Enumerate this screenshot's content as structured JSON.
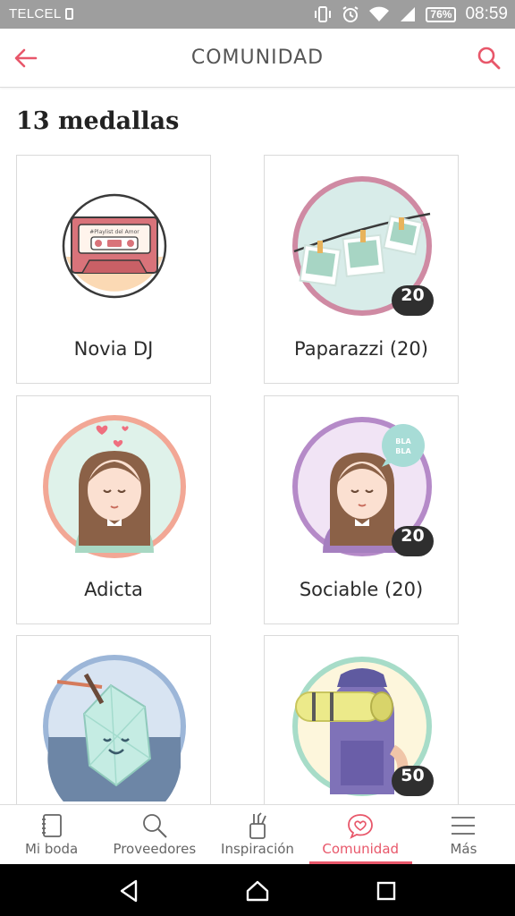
{
  "status_bar": {
    "carrier": "TELCEL",
    "battery": "76%",
    "time": "08:59"
  },
  "header": {
    "title": "COMUNIDAD"
  },
  "count_heading": "13 medallas",
  "medals": [
    {
      "label": "Novia DJ",
      "badge": ""
    },
    {
      "label": "Paparazzi (20)",
      "badge": "20"
    },
    {
      "label": "Adicta",
      "badge": ""
    },
    {
      "label": "Sociable (20)",
      "badge": "20"
    },
    {
      "label": "",
      "badge": ""
    },
    {
      "label": "",
      "badge": "50"
    }
  ],
  "art_text": {
    "cassette": "#Playlist del Amor",
    "bubble_line1": "BLA",
    "bubble_line2": "BLA"
  },
  "bottom_nav": [
    {
      "label": "Mi boda",
      "icon": "notebook-icon"
    },
    {
      "label": "Proveedores",
      "icon": "search-icon"
    },
    {
      "label": "Inspiración",
      "icon": "pencil-cup-icon"
    },
    {
      "label": "Comunidad",
      "icon": "chat-heart-icon",
      "active": true
    },
    {
      "label": "Más",
      "icon": "menu-icon"
    }
  ],
  "colors": {
    "accent": "#e8576a",
    "status_bar": "#9e9e9e",
    "badge": "#2f2f2f"
  }
}
